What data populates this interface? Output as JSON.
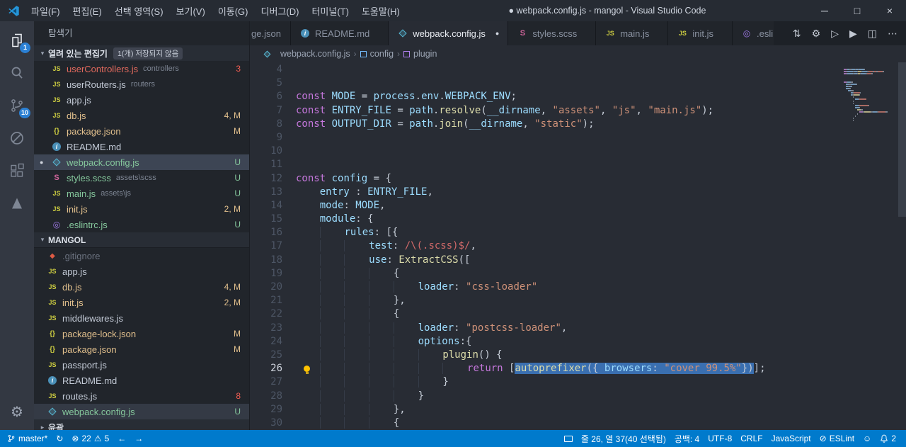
{
  "colors": {
    "status_bar": "#007acc",
    "activity_badge": "#2b80d4",
    "selection": "#3a6fb0",
    "git_modified": "#e2c08d",
    "git_untracked": "#85c79c",
    "error": "#f25d52",
    "accent": "#56b6d2"
  },
  "title_bar": {
    "menus": [
      "파일(F)",
      "편집(E)",
      "선택 영역(S)",
      "보기(V)",
      "이동(G)",
      "디버그(D)",
      "터미널(T)",
      "도움말(H)"
    ],
    "title": "● webpack.config.js - mangol - Visual Studio Code",
    "minimize": "─",
    "maximize": "□",
    "close": "×"
  },
  "activity_bar": {
    "explorer_badge": "1",
    "scm_badge": "10"
  },
  "sidebar": {
    "title": "탐색기",
    "open_editors": {
      "label": "열려 있는 편집기",
      "badge": "1(개) 저장되지 않음",
      "items": [
        {
          "icon": "js",
          "name": "userControllers.js",
          "detail": "controllers",
          "badge": "3",
          "color": "c-error",
          "badge_color": "b-err"
        },
        {
          "icon": "js",
          "name": "userRouters.js",
          "detail": "routers"
        },
        {
          "icon": "js",
          "name": "app.js"
        },
        {
          "icon": "js",
          "name": "db.js",
          "badge": "4, M",
          "color": "c-mod",
          "badge_color": "b-mod"
        },
        {
          "icon": "json",
          "name": "package.json",
          "badge": "M",
          "color": "c-mod",
          "badge_color": "b-mod"
        },
        {
          "icon": "info",
          "name": "README.md"
        },
        {
          "icon": "webpack",
          "name": "webpack.config.js",
          "dirty": true,
          "selected": true,
          "badge": "U",
          "color": "c-unt",
          "badge_color": "b-unt"
        },
        {
          "icon": "scss",
          "name": "styles.scss",
          "detail": "assets\\scss",
          "badge": "U",
          "color": "c-unt",
          "badge_color": "b-unt"
        },
        {
          "icon": "js",
          "name": "main.js",
          "detail": "assets\\js",
          "badge": "U",
          "color": "c-unt",
          "badge_color": "b-unt"
        },
        {
          "icon": "js",
          "name": "init.js",
          "badge": "2, M",
          "color": "c-mod",
          "badge_color": "b-mod"
        },
        {
          "icon": "eslint",
          "name": ".eslintrc.js",
          "badge": "U",
          "color": "c-unt",
          "badge_color": "b-unt"
        }
      ]
    },
    "folder": {
      "label": "MANGOL",
      "items": [
        {
          "icon": "git",
          "name": ".gitignore",
          "color": "c-dim"
        },
        {
          "icon": "js",
          "name": "app.js"
        },
        {
          "icon": "js",
          "name": "db.js",
          "badge": "4, M",
          "color": "c-mod",
          "badge_color": "b-mod"
        },
        {
          "icon": "js",
          "name": "init.js",
          "badge": "2, M",
          "color": "c-mod",
          "badge_color": "b-mod"
        },
        {
          "icon": "js",
          "name": "middlewares.js"
        },
        {
          "icon": "json",
          "name": "package-lock.json",
          "badge": "M",
          "color": "c-mod",
          "badge_color": "b-mod"
        },
        {
          "icon": "json",
          "name": "package.json",
          "badge": "M",
          "color": "c-mod",
          "badge_color": "b-mod"
        },
        {
          "icon": "js",
          "name": "passport.js"
        },
        {
          "icon": "info",
          "name": "README.md"
        },
        {
          "icon": "js",
          "name": "routes.js",
          "badge": "8",
          "badge_color": "b-err"
        },
        {
          "icon": "webpack",
          "name": "webpack.config.js",
          "active": true,
          "badge": "U",
          "color": "c-unt",
          "badge_color": "b-unt"
        }
      ]
    },
    "outline_label": "윤곽"
  },
  "tabs": [
    {
      "label": "ge.json",
      "partial_first": true
    },
    {
      "label": "README.md",
      "icon": "info"
    },
    {
      "label": "webpack.config.js",
      "icon": "webpack",
      "active": true,
      "dirty": true
    },
    {
      "label": "styles.scss",
      "icon": "scss"
    },
    {
      "label": "main.js",
      "icon": "js"
    },
    {
      "label": "init.js",
      "icon": "js"
    },
    {
      "label": ".esli",
      "icon": "eslint"
    }
  ],
  "tab_actions": [
    {
      "icon": "sync"
    },
    {
      "icon": "settings"
    },
    {
      "icon": "run"
    },
    {
      "icon": "run-alt"
    },
    {
      "icon": "split-editor"
    },
    {
      "icon": "more"
    }
  ],
  "breadcrumb": [
    {
      "label": "webpack.config.js",
      "icon": "webpack"
    },
    {
      "label": "config",
      "icon": "symbol-object"
    },
    {
      "label": "plugin",
      "ic on": "x",
      "icon": "symbol-method"
    }
  ],
  "editor": {
    "lines": [
      {
        "n": 4,
        "t": []
      },
      {
        "n": 5,
        "t": []
      },
      {
        "n": 6,
        "t": [
          [
            "k",
            "const"
          ],
          [
            "p",
            " "
          ],
          [
            "v",
            "MODE"
          ],
          [
            "p",
            " = "
          ],
          [
            "v",
            "process"
          ],
          [
            "p",
            "."
          ],
          [
            "v",
            "env"
          ],
          [
            "p",
            "."
          ],
          [
            "v",
            "WEBPACK_ENV"
          ],
          [
            "p",
            ";"
          ]
        ]
      },
      {
        "n": 7,
        "t": [
          [
            "k",
            "const"
          ],
          [
            "p",
            " "
          ],
          [
            "v",
            "ENTRY_FILE"
          ],
          [
            "p",
            " = "
          ],
          [
            "v",
            "path"
          ],
          [
            "p",
            "."
          ],
          [
            "f",
            "resolve"
          ],
          [
            "p",
            "("
          ],
          [
            "v",
            "__dirname"
          ],
          [
            "p",
            ", "
          ],
          [
            "s",
            "\"assets\""
          ],
          [
            "p",
            ", "
          ],
          [
            "s",
            "\"js\""
          ],
          [
            "p",
            ", "
          ],
          [
            "s",
            "\"main.js\""
          ],
          [
            "p",
            ");"
          ]
        ]
      },
      {
        "n": 8,
        "t": [
          [
            "k",
            "const"
          ],
          [
            "p",
            " "
          ],
          [
            "v",
            "OUTPUT_DIR"
          ],
          [
            "p",
            " = "
          ],
          [
            "v",
            "path"
          ],
          [
            "p",
            "."
          ],
          [
            "f",
            "join"
          ],
          [
            "p",
            "("
          ],
          [
            "v",
            "__dirname"
          ],
          [
            "p",
            ", "
          ],
          [
            "s",
            "\"static\""
          ],
          [
            "p",
            ");"
          ]
        ]
      },
      {
        "n": 9,
        "t": []
      },
      {
        "n": 10,
        "t": []
      },
      {
        "n": 11,
        "t": []
      },
      {
        "n": 12,
        "t": [
          [
            "k",
            "const"
          ],
          [
            "p",
            " "
          ],
          [
            "v",
            "config"
          ],
          [
            "p",
            " = {"
          ]
        ]
      },
      {
        "n": 13,
        "i": 4,
        "t": [
          [
            "v",
            "entry"
          ],
          [
            "p",
            " : "
          ],
          [
            "v",
            "ENTRY_FILE"
          ],
          [
            "p",
            ","
          ]
        ]
      },
      {
        "n": 14,
        "i": 4,
        "t": [
          [
            "v",
            "mode"
          ],
          [
            "p",
            ": "
          ],
          [
            "v",
            "MODE"
          ],
          [
            "p",
            ","
          ]
        ]
      },
      {
        "n": 15,
        "i": 4,
        "t": [
          [
            "v",
            "module"
          ],
          [
            "p",
            ": {"
          ]
        ]
      },
      {
        "n": 16,
        "i": 8,
        "t": [
          [
            "v",
            "rules"
          ],
          [
            "p",
            ": [{"
          ]
        ]
      },
      {
        "n": 17,
        "i": 12,
        "t": [
          [
            "v",
            "test"
          ],
          [
            "p",
            ": "
          ],
          [
            "r",
            "/\\(.scss)$/"
          ],
          [
            "p",
            ","
          ]
        ]
      },
      {
        "n": 18,
        "i": 12,
        "t": [
          [
            "v",
            "use"
          ],
          [
            "p",
            ": "
          ],
          [
            "f",
            "ExtractCSS"
          ],
          [
            "p",
            "(["
          ]
        ]
      },
      {
        "n": 19,
        "i": 16,
        "t": [
          [
            "p",
            "{"
          ]
        ]
      },
      {
        "n": 20,
        "i": 20,
        "t": [
          [
            "v",
            "loader"
          ],
          [
            "p",
            ": "
          ],
          [
            "s",
            "\"css-loader\""
          ]
        ]
      },
      {
        "n": 21,
        "i": 16,
        "t": [
          [
            "p",
            "},"
          ]
        ]
      },
      {
        "n": 22,
        "i": 16,
        "t": [
          [
            "p",
            "{"
          ]
        ]
      },
      {
        "n": 23,
        "i": 20,
        "t": [
          [
            "v",
            "loader"
          ],
          [
            "p",
            ": "
          ],
          [
            "s",
            "\"postcss-loader\""
          ],
          [
            "p",
            ","
          ]
        ]
      },
      {
        "n": 24,
        "i": 20,
        "t": [
          [
            "v",
            "options"
          ],
          [
            "p",
            ":{"
          ]
        ]
      },
      {
        "n": 25,
        "i": 24,
        "t": [
          [
            "f",
            "plugin"
          ],
          [
            "p",
            "() {"
          ]
        ]
      },
      {
        "n": 26,
        "i": 28,
        "cur": true,
        "t": [
          [
            "k",
            "return"
          ],
          [
            "p",
            " ["
          ],
          [
            "f",
            "autoprefixer",
            "sel"
          ],
          [
            "p",
            "({ ",
            "sel"
          ],
          [
            "v",
            "browsers",
            "sel"
          ],
          [
            "p",
            ": ",
            "sel"
          ],
          [
            "s",
            "\"cover 99.5%\"",
            "sel"
          ],
          [
            "p",
            "})",
            "sel"
          ],
          [
            "p",
            "];"
          ]
        ]
      },
      {
        "n": 27,
        "i": 24,
        "t": [
          [
            "p",
            "}"
          ]
        ]
      },
      {
        "n": 28,
        "i": 20,
        "t": [
          [
            "p",
            "}"
          ]
        ]
      },
      {
        "n": 29,
        "i": 16,
        "t": [
          [
            "p",
            "},"
          ]
        ]
      },
      {
        "n": 30,
        "i": 16,
        "t": [
          [
            "p",
            "{"
          ]
        ]
      }
    ]
  },
  "status_bar": {
    "branch": "master*",
    "errors": "22",
    "warnings": "5",
    "cursor": "줄 26, 열 37(40 선택됨)",
    "spaces": "공백: 4",
    "encoding": "UTF-8",
    "eol": "CRLF",
    "language": "JavaScript",
    "eslint": "ESLint",
    "notifications": "2"
  }
}
